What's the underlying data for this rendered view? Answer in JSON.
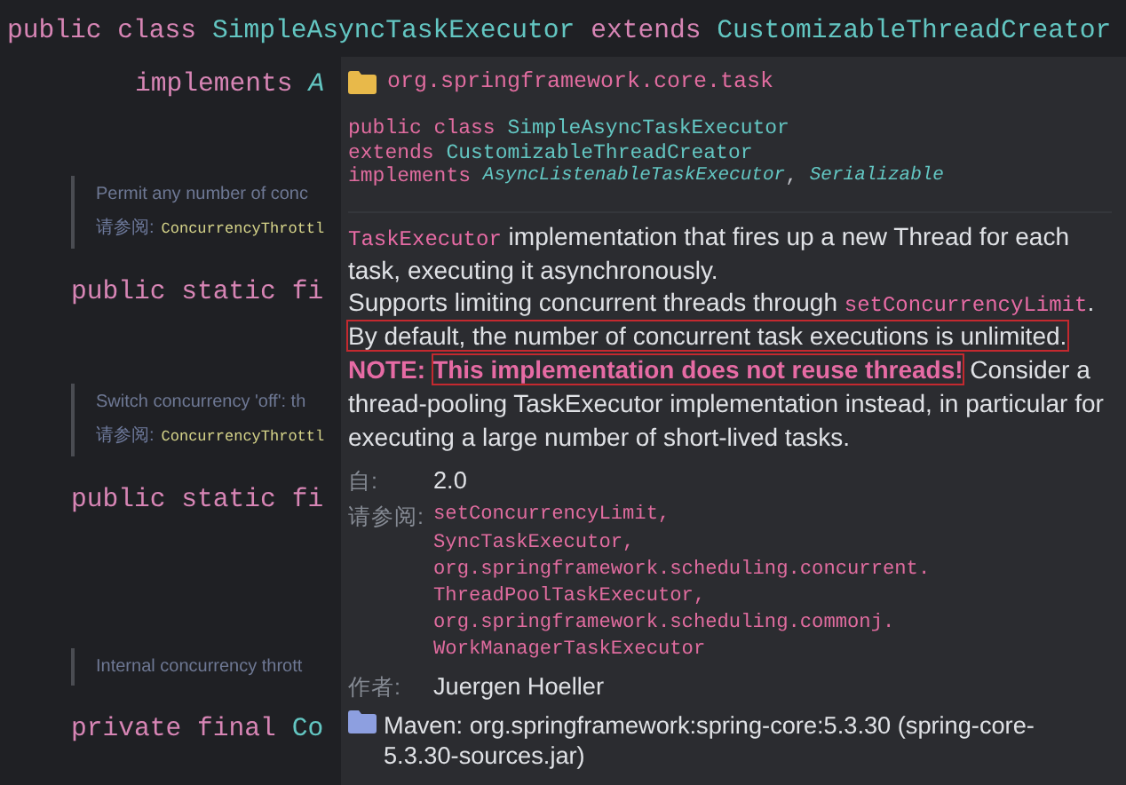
{
  "editor": {
    "items": [
      {
        "kind": "declaration",
        "tokens": [
          {
            "kind": "keyword",
            "text": "public class "
          },
          {
            "kind": "type",
            "text": "SimpleAsyncTaskExecutor "
          },
          {
            "kind": "keyword",
            "text": "extends "
          },
          {
            "kind": "type",
            "text": "CustomizableThreadCreator"
          }
        ]
      },
      {
        "kind": "continuation",
        "tokens": [
          {
            "kind": "keyword",
            "text": "implements "
          },
          {
            "kind": "interface",
            "text": "A"
          }
        ]
      },
      {
        "kind": "doc",
        "text": "Permit any number of conc",
        "see_label": "请参阅:",
        "see_ref": "ConcurrencyThrottl"
      },
      {
        "kind": "member",
        "tokens": [
          {
            "kind": "keyword",
            "text": "public static fi"
          }
        ]
      },
      {
        "kind": "doc",
        "text": "Switch concurrency 'off': th",
        "see_label": "请参阅:",
        "see_ref": "ConcurrencyThrottl"
      },
      {
        "kind": "member",
        "tokens": [
          {
            "kind": "keyword",
            "text": "public static fi"
          }
        ]
      },
      {
        "kind": "blank"
      },
      {
        "kind": "doc",
        "text": "Internal concurrency thrott"
      },
      {
        "kind": "member",
        "tokens": [
          {
            "kind": "keyword",
            "text": "private final "
          },
          {
            "kind": "type",
            "text": "Co"
          }
        ]
      }
    ]
  },
  "popup": {
    "package": "org.springframework.core.task",
    "signature": [
      [
        {
          "kind": "keyword",
          "text": "public class "
        },
        {
          "kind": "type",
          "text": "SimpleAsyncTaskExecutor"
        }
      ],
      [
        {
          "kind": "keyword",
          "text": "extends "
        },
        {
          "kind": "type",
          "text": "CustomizableThreadCreator"
        }
      ],
      [
        {
          "kind": "keyword",
          "text": "implements "
        },
        {
          "kind": "interface",
          "text": "AsyncListenableTaskExecutor"
        },
        {
          "kind": "plain",
          "text": ", "
        },
        {
          "kind": "interface",
          "text": "Serializable"
        }
      ]
    ],
    "description": [
      [
        {
          "kind": "code",
          "text": "TaskExecutor"
        },
        {
          "kind": "text",
          "text": " implementation that fires up a new Thread for each task, executing it asynchronously."
        }
      ],
      [
        {
          "kind": "text",
          "text": "Supports limiting concurrent threads through "
        },
        {
          "kind": "code",
          "text": "setConcurrencyLimit"
        },
        {
          "kind": "text",
          "text": "."
        }
      ],
      [
        {
          "kind": "text",
          "text": "By default, the number of concurrent task executions is unlimited.",
          "boxed": true
        }
      ],
      [
        {
          "kind": "strong",
          "text": "NOTE:"
        },
        {
          "kind": "strong",
          "text": "This implementation does not reuse threads!",
          "boxed": true
        },
        {
          "kind": "text",
          "text": " Consider a thread-pooling TaskExecutor implementation instead, in particular for executing a large number of short-lived tasks."
        }
      ]
    ],
    "since": {
      "label": "自:",
      "value": "2.0"
    },
    "see_also": {
      "label": "请参阅:",
      "links": [
        "setConcurrencyLimit,",
        "SyncTaskExecutor,",
        "org.springframework.scheduling.concurrent.ThreadPoolTaskExecutor,",
        "org.springframework.scheduling.commonj.WorkManagerTaskExecutor"
      ]
    },
    "author": {
      "label": "作者:",
      "value": "Juergen Hoeller"
    },
    "source": "Maven: org.springframework:spring-core:5.3.30 (spring-core-5.3.30-sources.jar)"
  }
}
